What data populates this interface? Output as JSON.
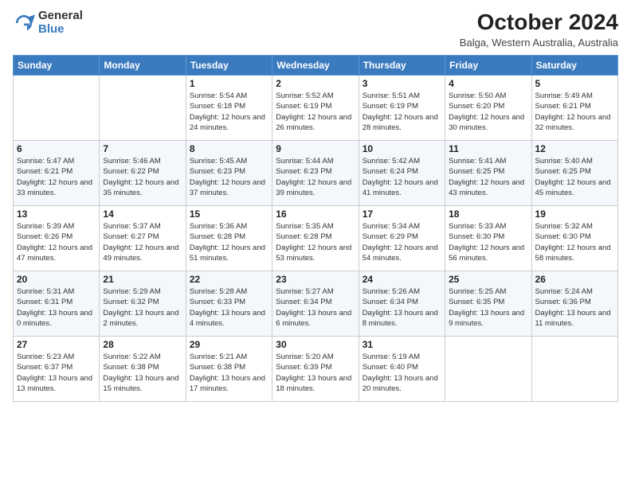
{
  "logo": {
    "general": "General",
    "blue": "Blue"
  },
  "header": {
    "month": "October 2024",
    "location": "Balga, Western Australia, Australia"
  },
  "weekdays": [
    "Sunday",
    "Monday",
    "Tuesday",
    "Wednesday",
    "Thursday",
    "Friday",
    "Saturday"
  ],
  "weeks": [
    [
      {
        "num": "",
        "detail": ""
      },
      {
        "num": "",
        "detail": ""
      },
      {
        "num": "1",
        "detail": "Sunrise: 5:54 AM\nSunset: 6:18 PM\nDaylight: 12 hours and 24 minutes."
      },
      {
        "num": "2",
        "detail": "Sunrise: 5:52 AM\nSunset: 6:19 PM\nDaylight: 12 hours and 26 minutes."
      },
      {
        "num": "3",
        "detail": "Sunrise: 5:51 AM\nSunset: 6:19 PM\nDaylight: 12 hours and 28 minutes."
      },
      {
        "num": "4",
        "detail": "Sunrise: 5:50 AM\nSunset: 6:20 PM\nDaylight: 12 hours and 30 minutes."
      },
      {
        "num": "5",
        "detail": "Sunrise: 5:49 AM\nSunset: 6:21 PM\nDaylight: 12 hours and 32 minutes."
      }
    ],
    [
      {
        "num": "6",
        "detail": "Sunrise: 5:47 AM\nSunset: 6:21 PM\nDaylight: 12 hours and 33 minutes."
      },
      {
        "num": "7",
        "detail": "Sunrise: 5:46 AM\nSunset: 6:22 PM\nDaylight: 12 hours and 35 minutes."
      },
      {
        "num": "8",
        "detail": "Sunrise: 5:45 AM\nSunset: 6:23 PM\nDaylight: 12 hours and 37 minutes."
      },
      {
        "num": "9",
        "detail": "Sunrise: 5:44 AM\nSunset: 6:23 PM\nDaylight: 12 hours and 39 minutes."
      },
      {
        "num": "10",
        "detail": "Sunrise: 5:42 AM\nSunset: 6:24 PM\nDaylight: 12 hours and 41 minutes."
      },
      {
        "num": "11",
        "detail": "Sunrise: 5:41 AM\nSunset: 6:25 PM\nDaylight: 12 hours and 43 minutes."
      },
      {
        "num": "12",
        "detail": "Sunrise: 5:40 AM\nSunset: 6:25 PM\nDaylight: 12 hours and 45 minutes."
      }
    ],
    [
      {
        "num": "13",
        "detail": "Sunrise: 5:39 AM\nSunset: 6:26 PM\nDaylight: 12 hours and 47 minutes."
      },
      {
        "num": "14",
        "detail": "Sunrise: 5:37 AM\nSunset: 6:27 PM\nDaylight: 12 hours and 49 minutes."
      },
      {
        "num": "15",
        "detail": "Sunrise: 5:36 AM\nSunset: 6:28 PM\nDaylight: 12 hours and 51 minutes."
      },
      {
        "num": "16",
        "detail": "Sunrise: 5:35 AM\nSunset: 6:28 PM\nDaylight: 12 hours and 53 minutes."
      },
      {
        "num": "17",
        "detail": "Sunrise: 5:34 AM\nSunset: 6:29 PM\nDaylight: 12 hours and 54 minutes."
      },
      {
        "num": "18",
        "detail": "Sunrise: 5:33 AM\nSunset: 6:30 PM\nDaylight: 12 hours and 56 minutes."
      },
      {
        "num": "19",
        "detail": "Sunrise: 5:32 AM\nSunset: 6:30 PM\nDaylight: 12 hours and 58 minutes."
      }
    ],
    [
      {
        "num": "20",
        "detail": "Sunrise: 5:31 AM\nSunset: 6:31 PM\nDaylight: 13 hours and 0 minutes."
      },
      {
        "num": "21",
        "detail": "Sunrise: 5:29 AM\nSunset: 6:32 PM\nDaylight: 13 hours and 2 minutes."
      },
      {
        "num": "22",
        "detail": "Sunrise: 5:28 AM\nSunset: 6:33 PM\nDaylight: 13 hours and 4 minutes."
      },
      {
        "num": "23",
        "detail": "Sunrise: 5:27 AM\nSunset: 6:34 PM\nDaylight: 13 hours and 6 minutes."
      },
      {
        "num": "24",
        "detail": "Sunrise: 5:26 AM\nSunset: 6:34 PM\nDaylight: 13 hours and 8 minutes."
      },
      {
        "num": "25",
        "detail": "Sunrise: 5:25 AM\nSunset: 6:35 PM\nDaylight: 13 hours and 9 minutes."
      },
      {
        "num": "26",
        "detail": "Sunrise: 5:24 AM\nSunset: 6:36 PM\nDaylight: 13 hours and 11 minutes."
      }
    ],
    [
      {
        "num": "27",
        "detail": "Sunrise: 5:23 AM\nSunset: 6:37 PM\nDaylight: 13 hours and 13 minutes."
      },
      {
        "num": "28",
        "detail": "Sunrise: 5:22 AM\nSunset: 6:38 PM\nDaylight: 13 hours and 15 minutes."
      },
      {
        "num": "29",
        "detail": "Sunrise: 5:21 AM\nSunset: 6:38 PM\nDaylight: 13 hours and 17 minutes."
      },
      {
        "num": "30",
        "detail": "Sunrise: 5:20 AM\nSunset: 6:39 PM\nDaylight: 13 hours and 18 minutes."
      },
      {
        "num": "31",
        "detail": "Sunrise: 5:19 AM\nSunset: 6:40 PM\nDaylight: 13 hours and 20 minutes."
      },
      {
        "num": "",
        "detail": ""
      },
      {
        "num": "",
        "detail": ""
      }
    ]
  ]
}
